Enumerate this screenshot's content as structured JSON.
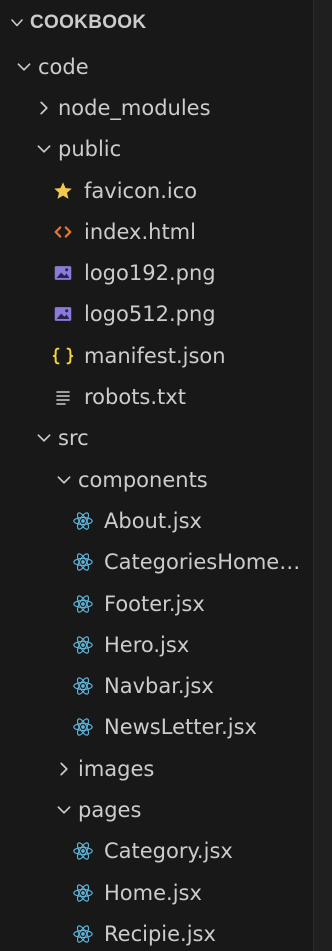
{
  "explorer": {
    "title": "COOKBOOK",
    "tree": [
      {
        "label": "code",
        "kind": "folder",
        "expanded": true,
        "depth": 0
      },
      {
        "label": "node_modules",
        "kind": "folder",
        "expanded": false,
        "depth": 1
      },
      {
        "label": "public",
        "kind": "folder",
        "expanded": true,
        "depth": 1
      },
      {
        "label": "favicon.ico",
        "kind": "file",
        "icon": "star-icon",
        "depth": 2
      },
      {
        "label": "index.html",
        "kind": "file",
        "icon": "html-icon",
        "depth": 2
      },
      {
        "label": "logo192.png",
        "kind": "file",
        "icon": "image-icon",
        "depth": 2
      },
      {
        "label": "logo512.png",
        "kind": "file",
        "icon": "image-icon",
        "depth": 2
      },
      {
        "label": "manifest.json",
        "kind": "file",
        "icon": "json-icon",
        "depth": 2
      },
      {
        "label": "robots.txt",
        "kind": "file",
        "icon": "text-file-icon",
        "depth": 2
      },
      {
        "label": "src",
        "kind": "folder",
        "expanded": true,
        "depth": 1
      },
      {
        "label": "components",
        "kind": "folder",
        "expanded": true,
        "depth": 2
      },
      {
        "label": "About.jsx",
        "kind": "file",
        "icon": "react-icon",
        "depth": 3
      },
      {
        "label": "CategoriesHome.jsx",
        "kind": "file",
        "icon": "react-icon",
        "depth": 3
      },
      {
        "label": "Footer.jsx",
        "kind": "file",
        "icon": "react-icon",
        "depth": 3
      },
      {
        "label": "Hero.jsx",
        "kind": "file",
        "icon": "react-icon",
        "depth": 3
      },
      {
        "label": "Navbar.jsx",
        "kind": "file",
        "icon": "react-icon",
        "depth": 3
      },
      {
        "label": "NewsLetter.jsx",
        "kind": "file",
        "icon": "react-icon",
        "depth": 3
      },
      {
        "label": "images",
        "kind": "folder",
        "expanded": false,
        "depth": 2
      },
      {
        "label": "pages",
        "kind": "folder",
        "expanded": true,
        "depth": 2
      },
      {
        "label": "Category.jsx",
        "kind": "file",
        "icon": "react-icon",
        "depth": 3
      },
      {
        "label": "Home.jsx",
        "kind": "file",
        "icon": "react-icon",
        "depth": 3
      },
      {
        "label": "Recipie.jsx",
        "kind": "file",
        "icon": "react-icon",
        "depth": 3
      }
    ]
  },
  "colors": {
    "background": "#181818",
    "text": "#cccccc",
    "star": "#f2c94c",
    "html": "#e37933",
    "image": "#8d7ad8",
    "json": "#f1d335",
    "react": "#5fb3d9"
  }
}
